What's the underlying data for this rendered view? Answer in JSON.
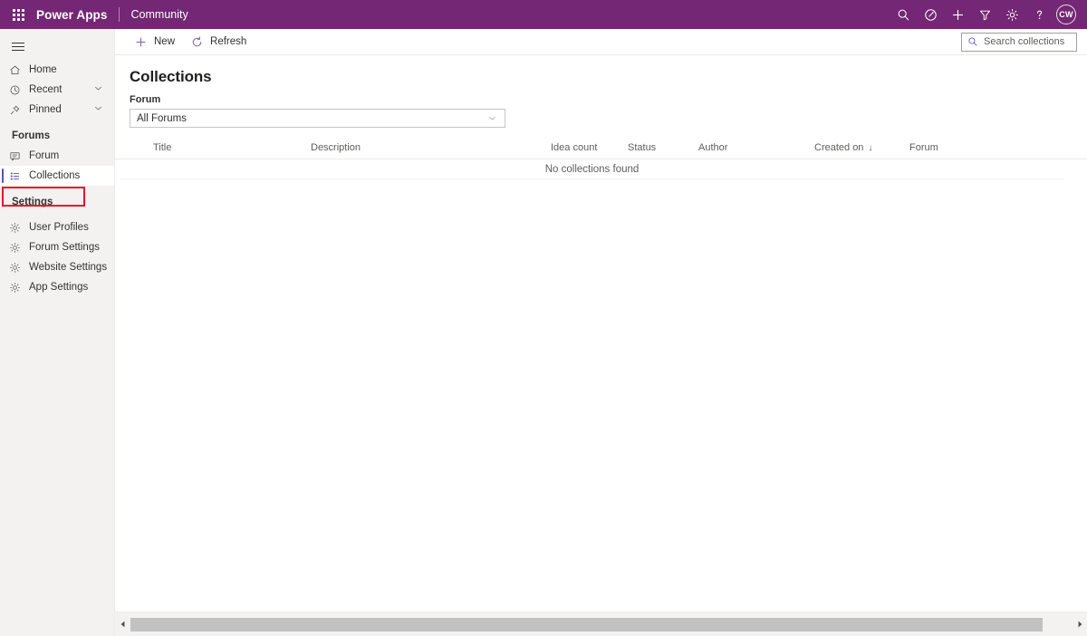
{
  "header": {
    "waffle_label": "app-launcher",
    "brand": "Power Apps",
    "app_name": "Community",
    "actions": [
      {
        "name": "search-icon",
        "label": "Search"
      },
      {
        "name": "environment-icon",
        "label": "Environment"
      },
      {
        "name": "add-icon",
        "label": "New"
      },
      {
        "name": "filter-icon",
        "label": "Filter"
      },
      {
        "name": "settings-gear-icon",
        "label": "Settings"
      },
      {
        "name": "help-icon",
        "label": "Help"
      }
    ],
    "avatar_initials": "CW",
    "accent_color": "#742774"
  },
  "sidebar": {
    "hamburger_label": "Expand navigation",
    "items": [
      {
        "label": "Home",
        "icon": "home-icon",
        "expandable": false
      },
      {
        "label": "Recent",
        "icon": "clock-icon",
        "expandable": true
      },
      {
        "label": "Pinned",
        "icon": "pin-icon",
        "expandable": true
      }
    ],
    "groups": [
      {
        "title": "Forums",
        "items": [
          {
            "label": "Forum",
            "icon": "message-icon",
            "selected": false
          },
          {
            "label": "Collections",
            "icon": "list-icon",
            "selected": true
          }
        ]
      },
      {
        "title": "Settings",
        "items": [
          {
            "label": "User Profiles",
            "icon": "gear-icon",
            "selected": false
          },
          {
            "label": "Forum Settings",
            "icon": "gear-icon",
            "selected": false
          },
          {
            "label": "Website Settings",
            "icon": "gear-icon",
            "selected": false
          },
          {
            "label": "App Settings",
            "icon": "gear-icon",
            "selected": false
          }
        ]
      }
    ],
    "highlight_color": "#e8112d",
    "selected_accent": "#5a4ec2"
  },
  "command_bar": {
    "new_label": "New",
    "refresh_label": "Refresh",
    "search_placeholder": "Search collections"
  },
  "main": {
    "page_title": "Collections",
    "filter_label": "Forum",
    "filter_value": "All Forums",
    "columns": [
      {
        "label": "Title",
        "sorted": false
      },
      {
        "label": "Description",
        "sorted": false
      },
      {
        "label": "Idea count",
        "sorted": false
      },
      {
        "label": "Status",
        "sorted": false
      },
      {
        "label": "Author",
        "sorted": false
      },
      {
        "label": "Created on",
        "sorted": true,
        "sort_glyph": "↓"
      },
      {
        "label": "Forum",
        "sorted": false
      }
    ],
    "rows": [],
    "empty_message": "No collections found"
  },
  "scrollbar": {
    "left_arrow": "◀",
    "right_arrow": "▶"
  }
}
